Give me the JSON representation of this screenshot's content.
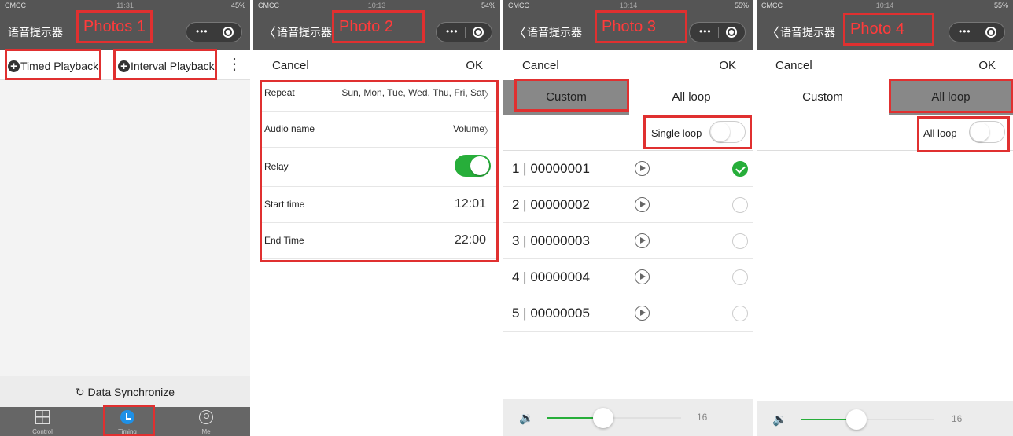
{
  "status": {
    "carrier": "CMCC",
    "signal": "哈́l",
    "bt": "✱ ○ ▤"
  },
  "p1": {
    "time": "11:31",
    "battery": "45%",
    "title": "语音提示器",
    "tag": "Photos 1",
    "timed": "Timed Playback",
    "interval": "Interval Playback",
    "more": "⋮",
    "sync": "Data Synchronize",
    "sync_icon": "↻",
    "tabs": [
      {
        "label": "Control",
        "icon": "grid-icon"
      },
      {
        "label": "Timing",
        "icon": "clock-icon"
      },
      {
        "label": "Me",
        "icon": "person-icon"
      }
    ]
  },
  "p2": {
    "time": "10:13",
    "battery": "54%",
    "title": "语音提示器",
    "tag": "Photo 2",
    "cancel": "Cancel",
    "ok": "OK",
    "repeat_label": "Repeat",
    "repeat_value": "Sun, Mon, Tue, Wed, Thu, Fri, Sat",
    "audio_label": "Audio name",
    "audio_value": "Volume",
    "relay_label": "Relay",
    "relay_on": true,
    "start_label": "Start time",
    "start_value": "12:01",
    "end_label": "End Time",
    "end_value": "22:00"
  },
  "p3": {
    "time": "10:14",
    "battery": "55%",
    "title": "语音提示器",
    "tag": "Photo 3",
    "cancel": "Cancel",
    "ok": "OK",
    "seg_custom": "Custom",
    "seg_all": "All loop",
    "selected": "Custom",
    "loop_label": "Single loop",
    "loop_on": false,
    "tracks": [
      {
        "label": "1 | 00000001",
        "checked": true
      },
      {
        "label": "2 | 00000002",
        "checked": false
      },
      {
        "label": "3 | 00000003",
        "checked": false
      },
      {
        "label": "4 | 00000004",
        "checked": false
      },
      {
        "label": "5 | 00000005",
        "checked": false
      }
    ],
    "volume": 16,
    "volume_fraction": 0.42
  },
  "p4": {
    "time": "10:14",
    "battery": "55%",
    "title": "语音提示器",
    "tag": "Photo 4",
    "cancel": "Cancel",
    "ok": "OK",
    "seg_custom": "Custom",
    "seg_all": "All loop",
    "selected": "All loop",
    "loop_label": "All loop",
    "loop_on": false,
    "volume": 16,
    "volume_fraction": 0.42
  },
  "icons": {
    "speaker": "🔉",
    "back": "〈",
    "chevron": "〉",
    "capsule_dots": "•••"
  },
  "colors": {
    "accent_green": "#27ae3a",
    "highlight_red": "#e03030",
    "timing_blue": "#1e90e6"
  }
}
